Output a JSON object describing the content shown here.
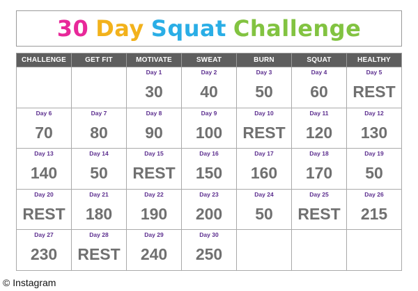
{
  "title": {
    "part1": "30",
    "part2": "Day",
    "part3": "Squat",
    "part4": "Challenge"
  },
  "headers": [
    "CHALLENGE",
    "GET FIT",
    "MOTIVATE",
    "SWEAT",
    "BURN",
    "SQUAT",
    "HEALTHY"
  ],
  "weeks": [
    [
      null,
      null,
      {
        "day": "Day 1",
        "reps": "30"
      },
      {
        "day": "Day 2",
        "reps": "40"
      },
      {
        "day": "Day 3",
        "reps": "50"
      },
      {
        "day": "Day 4",
        "reps": "60"
      },
      {
        "day": "Day 5",
        "reps": "REST"
      }
    ],
    [
      {
        "day": "Day 6",
        "reps": "70"
      },
      {
        "day": "Day 7",
        "reps": "80"
      },
      {
        "day": "Day 8",
        "reps": "90"
      },
      {
        "day": "Day 9",
        "reps": "100"
      },
      {
        "day": "Day 10",
        "reps": "REST"
      },
      {
        "day": "Day 11",
        "reps": "120"
      },
      {
        "day": "Day 12",
        "reps": "130"
      }
    ],
    [
      {
        "day": "Day 13",
        "reps": "140"
      },
      {
        "day": "Day 14",
        "reps": "50"
      },
      {
        "day": "Day 15",
        "reps": "REST"
      },
      {
        "day": "Day 16",
        "reps": "150"
      },
      {
        "day": "Day 17",
        "reps": "160"
      },
      {
        "day": "Day 18",
        "reps": "170"
      },
      {
        "day": "Day 19",
        "reps": "50"
      }
    ],
    [
      {
        "day": "Day 20",
        "reps": "REST"
      },
      {
        "day": "Day 21",
        "reps": "180"
      },
      {
        "day": "Day 22",
        "reps": "190"
      },
      {
        "day": "Day 23",
        "reps": "200"
      },
      {
        "day": "Day 24",
        "reps": "50"
      },
      {
        "day": "Day 25",
        "reps": "REST"
      },
      {
        "day": "Day 26",
        "reps": "215"
      }
    ],
    [
      {
        "day": "Day 27",
        "reps": "230"
      },
      {
        "day": "Day 28",
        "reps": "REST"
      },
      {
        "day": "Day 29",
        "reps": "240"
      },
      {
        "day": "Day 30",
        "reps": "250"
      },
      null,
      null,
      null
    ]
  ],
  "credit": "© Instagram",
  "colors": {
    "title_pink": "#e8289a",
    "title_orange": "#f2b21c",
    "title_blue": "#2aaee6",
    "title_green": "#82c341",
    "header_bg": "#5e5e5e",
    "day_label": "#5b2d8e",
    "reps_text": "#707070"
  }
}
